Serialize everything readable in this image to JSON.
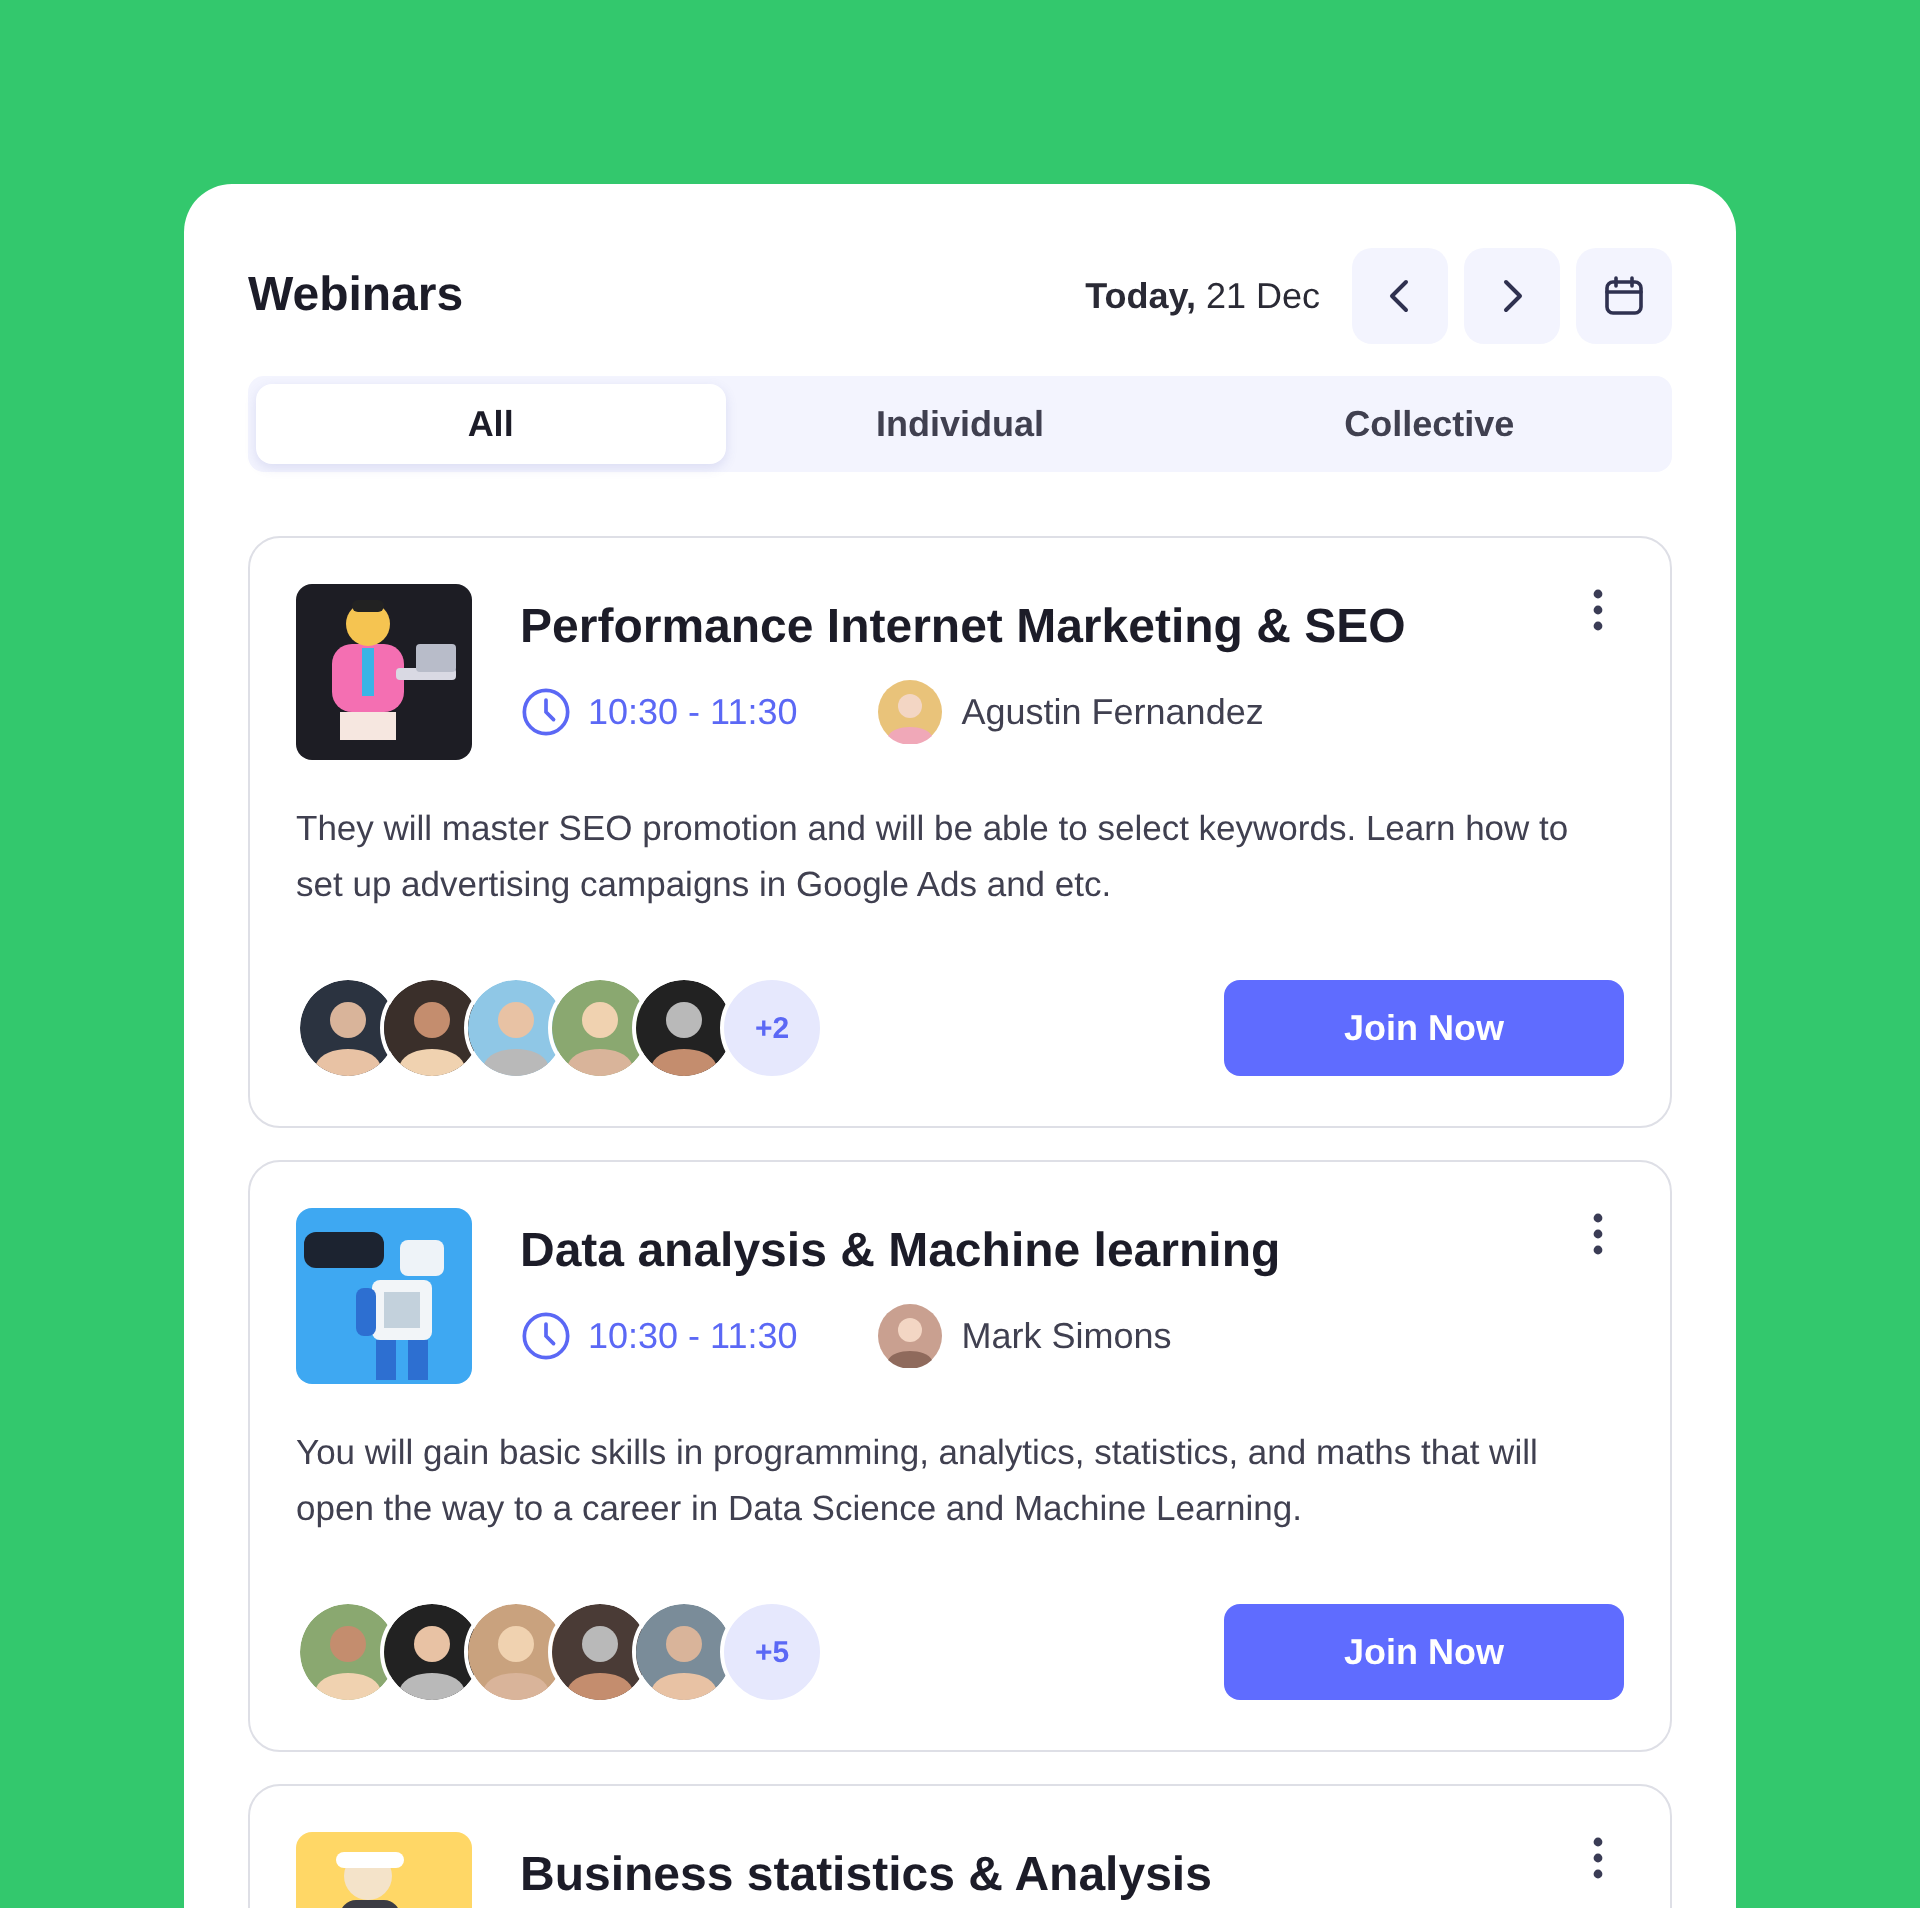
{
  "header": {
    "title": "Webinars",
    "date": "**Today,** 21 Dec"
  },
  "tabs": [
    {
      "label": "All",
      "selected": true
    },
    {
      "label": "Individual",
      "selected": false
    },
    {
      "label": "Collective",
      "selected": false
    }
  ],
  "webinars": [
    {
      "title": "Performance Internet Marketing & SEO",
      "time": "10:30 - 11:30",
      "host": "Agustin Fernandez",
      "description": "They will master SEO promotion and will be able to select keywords. Learn how to set up advertising campaigns in Google Ads and etc.",
      "more": "+2",
      "action": "Join Now"
    },
    {
      "title": "Data analysis & Machine learning",
      "time": "10:30 - 11:30",
      "host": "Mark Simons",
      "description": "You will gain basic skills in programming, analytics, statistics, and maths that will open the way to a career in Data Science and Machine Learning.",
      "more": "+5",
      "action": "Join Now"
    },
    {
      "title": "Business statistics & Analysis"
    }
  ]
}
